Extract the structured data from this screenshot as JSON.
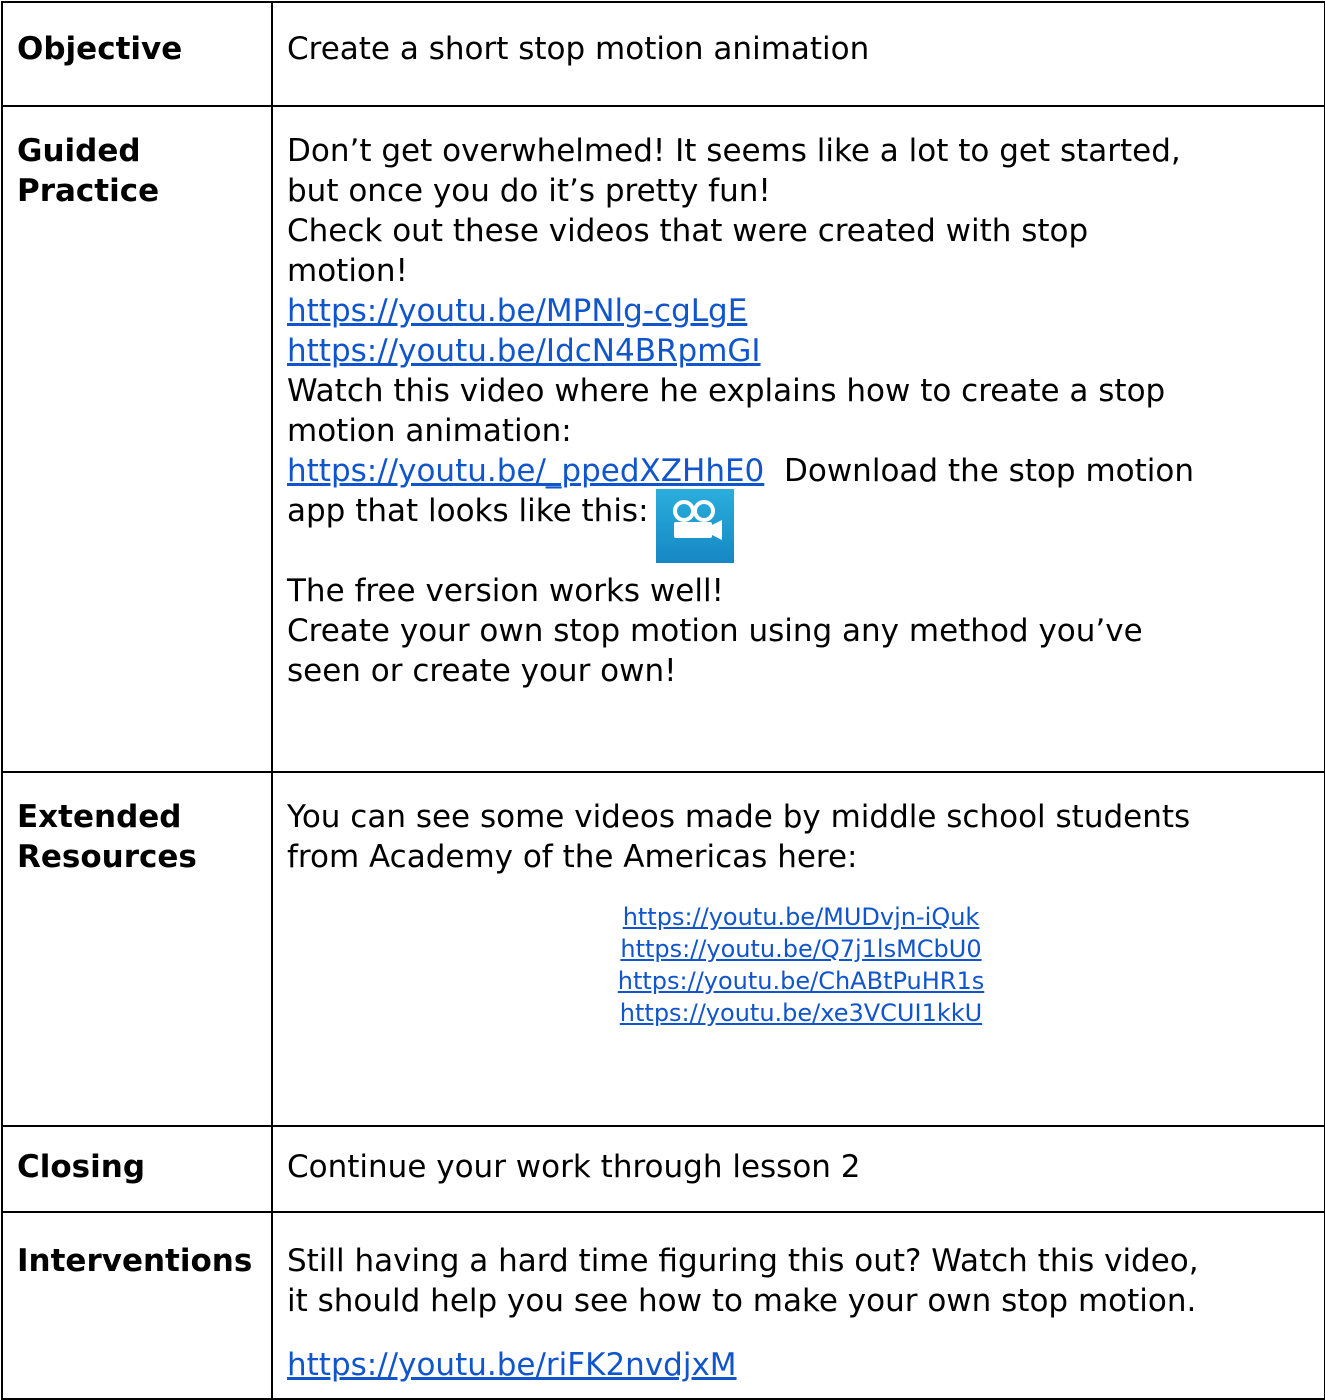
{
  "objective": {
    "label": "Objective",
    "text": "Create a short stop motion animation"
  },
  "guided": {
    "label_line1": "Guided",
    "label_line2": "Practice",
    "lines": [
      "Don’t get overwhelmed!  It seems like a lot to get started,",
      "but once you do it’s pretty fun!",
      "Check out these videos that were created with stop",
      "motion!"
    ],
    "link1": "https://youtu.be/MPNlg-cgLgE",
    "link2": "https://youtu.be/IdcN4BRpmGI",
    "watch_line1": "Watch this video where he explains how to create a stop",
    "watch_line2": "motion animation:",
    "link3": "https://youtu.be/_ppedXZHhE0",
    "download_text": "  Download the stop motion",
    "app_text": "app that looks like this:",
    "app_icon": "stop-motion-app-icon",
    "free_version": "The free version works well!",
    "create_line1": "Create your own stop motion using any method you’ve",
    "create_line2": "seen or create your own!"
  },
  "extended": {
    "label_line1": "Extended",
    "label_line2": "Resources",
    "line1": "You can see some videos made by middle school students",
    "line2": "from Academy of the Americas here:",
    "links": [
      "https://youtu.be/MUDvjn-iQuk",
      "https://youtu.be/Q7j1lsMCbU0",
      "https://youtu.be/ChABtPuHR1s",
      "https://youtu.be/xe3VCUI1kkU"
    ]
  },
  "closing": {
    "label": "Closing",
    "text": "Continue your work through lesson 2"
  },
  "interventions": {
    "label": "Interventions",
    "line1": "Still having a hard time figuring this out?  Watch this video,",
    "line2": "it should help you see how to make your own stop motion.",
    "link": "https://youtu.be/riFK2nvdjxM"
  },
  "colors": {
    "link": "#1155cc",
    "icon": "#1f9fd3",
    "border": "#000000"
  }
}
